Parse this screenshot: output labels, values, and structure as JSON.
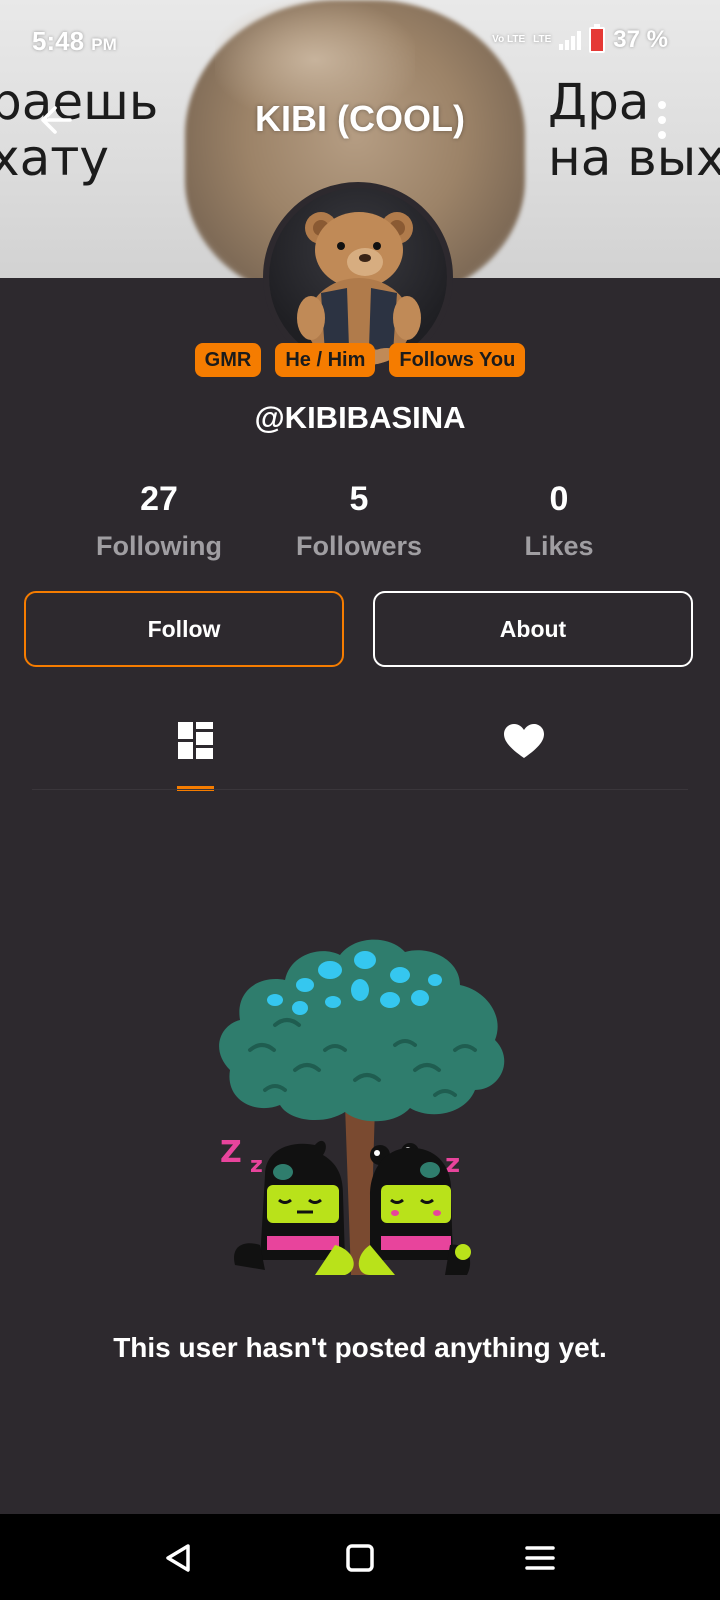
{
  "status_bar": {
    "time": "5:48",
    "meridiem": "PM",
    "volte": "Vo LTE",
    "lte": "LTE",
    "battery": "37 %"
  },
  "header": {
    "title": "KIBI (COOL)",
    "back_icon": "arrow-left-icon",
    "more_icon": "more-vertical-icon"
  },
  "banner": {
    "text_left": "раешь\nхату",
    "text_right": "Дра\nна вых"
  },
  "profile": {
    "badges": [
      "GMR",
      "He / Him",
      "Follows You"
    ],
    "username": "@KIBIBASINA"
  },
  "stats": [
    {
      "value": "27",
      "label": "Following"
    },
    {
      "value": "5",
      "label": "Followers"
    },
    {
      "value": "0",
      "label": "Likes"
    }
  ],
  "actions": {
    "follow_label": "Follow",
    "about_label": "About"
  },
  "tabs": [
    {
      "icon": "grid-icon",
      "active": true
    },
    {
      "icon": "heart-icon",
      "active": false
    }
  ],
  "empty_state": {
    "message": "This user hasn't posted anything yet."
  },
  "colors": {
    "background": "#2d292e",
    "accent": "#f57c00",
    "muted_text": "#a09ea2"
  },
  "nav_bar": {
    "icons": [
      "nav-back-icon",
      "nav-home-icon",
      "nav-menu-icon"
    ]
  }
}
